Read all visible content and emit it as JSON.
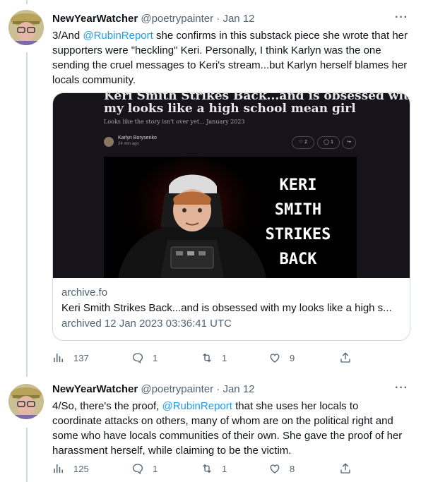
{
  "tweets": [
    {
      "name": "NewYearWatcher",
      "handle": "@poetrypainter",
      "sep": "·",
      "date": "Jan 12",
      "text_parts": {
        "p1": "3/And ",
        "mention": "@RubinReport",
        "p2": " she confirms in this substack piece she wrote that her supporters were \"heckling\" Keri.  Personally, I think Karlyn was the one sending the cruel messages to Keri's stream...but Karlyn herself blames her locals community."
      },
      "card": {
        "article_title_line1": "Keri Smith Strikes Back...and is obsessed with",
        "article_title_line2": "my looks like a high school mean girl",
        "article_subtitle": "Looks like the story isn't over yet... January 2023",
        "author_name": "Karlyn Borysenko",
        "author_time": "24 min ago",
        "likes_pill": "2",
        "comments_pill": "1",
        "poster_lines": [
          "KERI",
          "SMITH",
          "STRIKES",
          "BACK"
        ],
        "domain": "archive.fo",
        "title": "Keri Smith Strikes Back...and is obsessed with my looks like a high s...",
        "archived": "archived 12 Jan 2023 03:36:41 UTC"
      },
      "stats": {
        "views": "137",
        "replies": "1",
        "retweets": "1",
        "likes": "9"
      }
    },
    {
      "name": "NewYearWatcher",
      "handle": "@poetrypainter",
      "sep": "·",
      "date": "Jan 12",
      "text_parts": {
        "p1": "4/So, there's the proof, ",
        "mention": "@RubinReport",
        "p2": " that she uses her locals to coordinate attacks on others, many of whom are on the political right and some who have locals communities of their own.  She gave the proof of her harassment herself, while claiming to be the victim."
      },
      "stats": {
        "views": "125",
        "replies": "1",
        "retweets": "1",
        "likes": "8"
      }
    }
  ],
  "more_glyph": "···",
  "icons": [
    "views-icon",
    "reply-icon",
    "retweet-icon",
    "like-icon",
    "share-icon",
    "more-icon"
  ],
  "colors": {
    "mention": "#1d9bf0",
    "secondary": "#536471",
    "border": "#cfd9de"
  }
}
